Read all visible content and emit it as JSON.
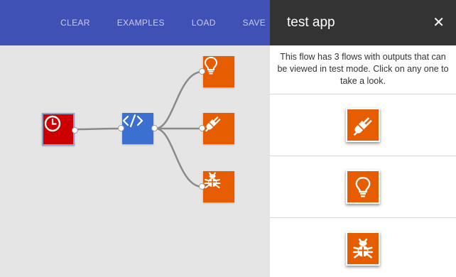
{
  "toolbar": {
    "buttons": [
      {
        "label": "CLEAR"
      },
      {
        "label": "EXAMPLES"
      },
      {
        "label": "LOAD"
      },
      {
        "label": "SAVE"
      }
    ],
    "background": "#3f51b5"
  },
  "canvas": {
    "nodes": [
      {
        "type": "timer",
        "icon": "clock-icon",
        "color": "#cc0000"
      },
      {
        "type": "code",
        "icon": "code-icon",
        "color": "#3b6fd0"
      },
      {
        "type": "output-light",
        "icon": "lightbulb-icon",
        "color": "#e65c00"
      },
      {
        "type": "output-plug",
        "icon": "plug-icon",
        "color": "#e65c00"
      },
      {
        "type": "output-debug",
        "icon": "bug-icon",
        "color": "#e65c00"
      }
    ]
  },
  "panel": {
    "title": "test app",
    "close_icon": "close-icon",
    "description": "This flow has 3 flows with outputs that can be viewed in test mode. Click on any one to take a look.",
    "flows": [
      {
        "icon": "plug-icon"
      },
      {
        "icon": "lightbulb-icon"
      },
      {
        "icon": "bug-icon"
      }
    ]
  }
}
